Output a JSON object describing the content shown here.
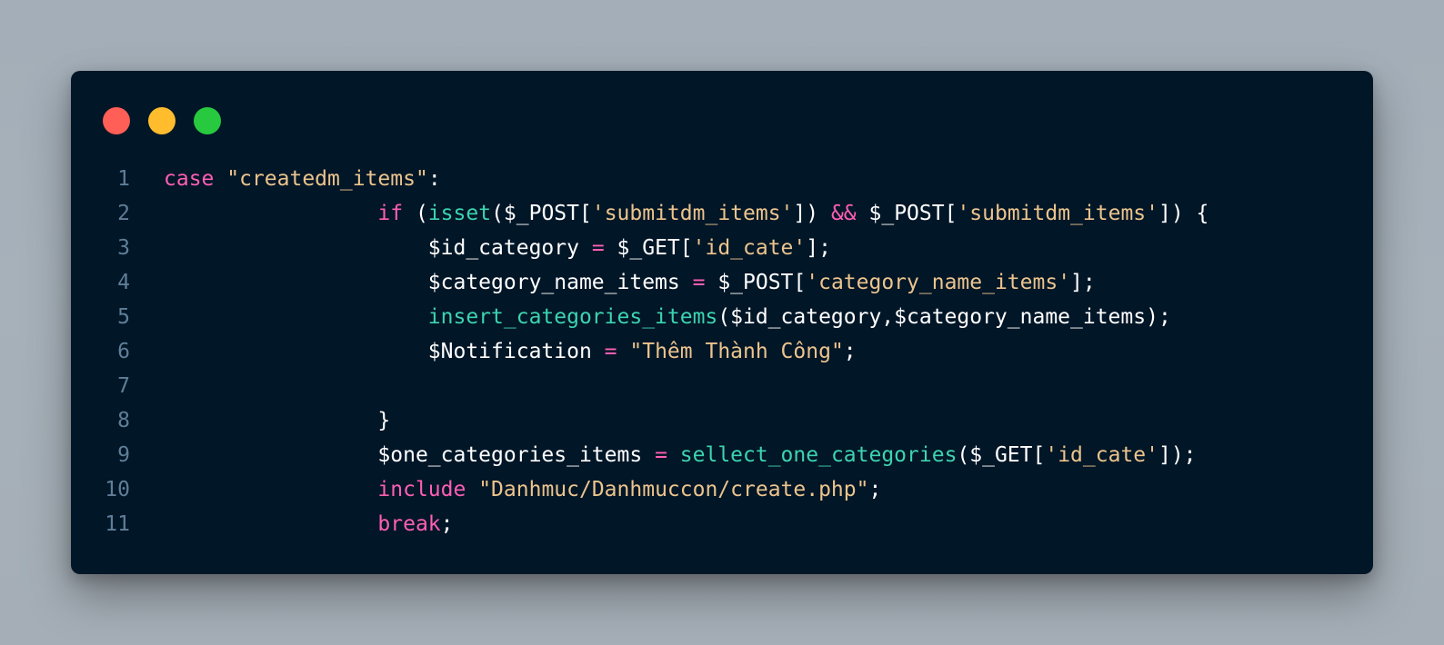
{
  "window": {
    "buttons": {
      "close_color": "#ff5f56",
      "minimize_color": "#ffbd2e",
      "maximize_color": "#27c93f"
    }
  },
  "code": {
    "lines": [
      {
        "number": "1",
        "tokens": [
          {
            "t": "case",
            "k": "keyword"
          },
          {
            "t": " ",
            "k": "punc"
          },
          {
            "t": "\"createdm_items\"",
            "k": "string"
          },
          {
            "t": ":",
            "k": "punc"
          }
        ]
      },
      {
        "number": "2",
        "tokens": [
          {
            "t": "                 ",
            "k": "punc"
          },
          {
            "t": "if",
            "k": "keyword"
          },
          {
            "t": " (",
            "k": "punc"
          },
          {
            "t": "isset",
            "k": "func"
          },
          {
            "t": "($_POST[",
            "k": "punc"
          },
          {
            "t": "'submitdm_items'",
            "k": "string"
          },
          {
            "t": "]) ",
            "k": "punc"
          },
          {
            "t": "&&",
            "k": "op"
          },
          {
            "t": " $_POST[",
            "k": "punc"
          },
          {
            "t": "'submitdm_items'",
            "k": "string"
          },
          {
            "t": "]) {",
            "k": "punc"
          }
        ]
      },
      {
        "number": "3",
        "tokens": [
          {
            "t": "                     ",
            "k": "punc"
          },
          {
            "t": "$id_category",
            "k": "var"
          },
          {
            "t": " ",
            "k": "punc"
          },
          {
            "t": "=",
            "k": "op"
          },
          {
            "t": " $_GET[",
            "k": "punc"
          },
          {
            "t": "'id_cate'",
            "k": "string"
          },
          {
            "t": "];",
            "k": "punc"
          }
        ]
      },
      {
        "number": "4",
        "tokens": [
          {
            "t": "                     ",
            "k": "punc"
          },
          {
            "t": "$category_name_items",
            "k": "var"
          },
          {
            "t": " ",
            "k": "punc"
          },
          {
            "t": "=",
            "k": "op"
          },
          {
            "t": " $_POST[",
            "k": "punc"
          },
          {
            "t": "'category_name_items'",
            "k": "string"
          },
          {
            "t": "];",
            "k": "punc"
          }
        ]
      },
      {
        "number": "5",
        "tokens": [
          {
            "t": "                     ",
            "k": "punc"
          },
          {
            "t": "insert_categories_items",
            "k": "func"
          },
          {
            "t": "($id_category,$category_name_items);",
            "k": "punc"
          }
        ]
      },
      {
        "number": "6",
        "tokens": [
          {
            "t": "                     ",
            "k": "punc"
          },
          {
            "t": "$Notification",
            "k": "var"
          },
          {
            "t": " ",
            "k": "punc"
          },
          {
            "t": "=",
            "k": "op"
          },
          {
            "t": " ",
            "k": "punc"
          },
          {
            "t": "\"Thêm Thành Công\"",
            "k": "string"
          },
          {
            "t": ";",
            "k": "punc"
          }
        ]
      },
      {
        "number": "7",
        "tokens": []
      },
      {
        "number": "8",
        "tokens": [
          {
            "t": "                 ",
            "k": "punc"
          },
          {
            "t": "}",
            "k": "punc"
          }
        ]
      },
      {
        "number": "9",
        "tokens": [
          {
            "t": "                 ",
            "k": "punc"
          },
          {
            "t": "$one_categories_items",
            "k": "var"
          },
          {
            "t": " ",
            "k": "punc"
          },
          {
            "t": "=",
            "k": "op"
          },
          {
            "t": " ",
            "k": "punc"
          },
          {
            "t": "sellect_one_categories",
            "k": "func"
          },
          {
            "t": "($_GET[",
            "k": "punc"
          },
          {
            "t": "'id_cate'",
            "k": "string"
          },
          {
            "t": "]);",
            "k": "punc"
          }
        ]
      },
      {
        "number": "10",
        "tokens": [
          {
            "t": "                 ",
            "k": "punc"
          },
          {
            "t": "include",
            "k": "keyword"
          },
          {
            "t": " ",
            "k": "punc"
          },
          {
            "t": "\"Danhmuc/Danhmuccon/create.php\"",
            "k": "string"
          },
          {
            "t": ";",
            "k": "punc"
          }
        ]
      },
      {
        "number": "11",
        "tokens": [
          {
            "t": "                 ",
            "k": "punc"
          },
          {
            "t": "break",
            "k": "keyword"
          },
          {
            "t": ";",
            "k": "punc"
          }
        ]
      }
    ]
  },
  "colors": {
    "background": "#a5aeb6",
    "editor_background": "#011627",
    "line_number": "#5f7e97",
    "keyword": "#ff5fb4",
    "string": "#ecc48d",
    "function": "#3dd4b0",
    "text": "#ffffff"
  }
}
